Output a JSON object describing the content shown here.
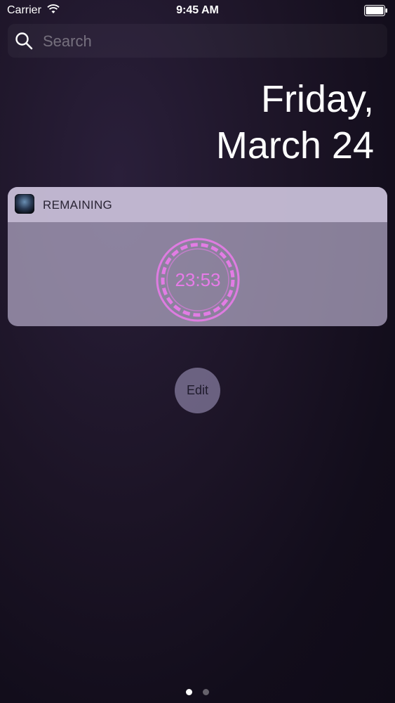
{
  "status_bar": {
    "carrier": "Carrier",
    "time": "9:45 AM"
  },
  "search": {
    "placeholder": "Search"
  },
  "date": {
    "line1": "Friday,",
    "line2": "March 24"
  },
  "widget": {
    "app_title": "REMAINING",
    "timer_value": "23:53",
    "accent_color": "#e77be8"
  },
  "edit_button": {
    "label": "Edit"
  },
  "page_indicator": {
    "total": 2,
    "current": 1
  },
  "icons": {
    "wifi": "wifi-icon",
    "battery": "battery-icon",
    "search": "search-icon",
    "app": "app-icon"
  }
}
